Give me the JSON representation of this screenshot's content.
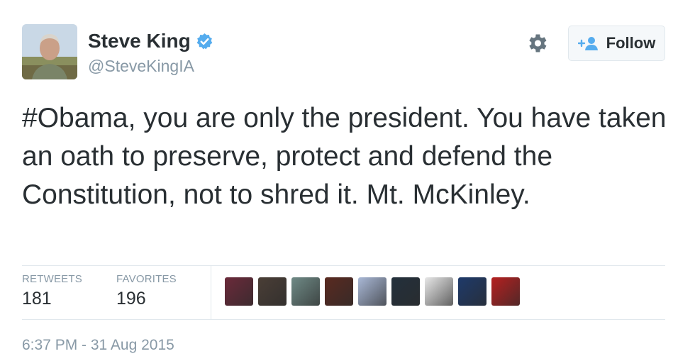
{
  "user": {
    "name": "Steve King",
    "handle": "@SteveKingIA",
    "verified": true
  },
  "actions": {
    "settings_icon": "gear-icon",
    "follow_label": "Follow",
    "follow_icon": "add-person-icon"
  },
  "tweet": {
    "text": "#Obama, you are only the president. You have taken an oath to preserve, protect and defend the Constitution, not to shred it. Mt. McKinley."
  },
  "stats": {
    "retweets_label": "RETWEETS",
    "retweets_value": "181",
    "favorites_label": "FAVORITES",
    "favorites_value": "196"
  },
  "favoriters": [
    {
      "name": "favoriter-avatar-1",
      "color": "#6b2a3a"
    },
    {
      "name": "favoriter-avatar-2",
      "color": "#4a3e36"
    },
    {
      "name": "favoriter-avatar-3",
      "color": "#6f8a86"
    },
    {
      "name": "favoriter-avatar-4",
      "color": "#5a2a20"
    },
    {
      "name": "favoriter-avatar-5",
      "color": "#a9b8d6"
    },
    {
      "name": "favoriter-avatar-6",
      "color": "#23303c"
    },
    {
      "name": "favoriter-avatar-7",
      "color": "#e8e8e8"
    },
    {
      "name": "favoriter-avatar-8",
      "color": "#1e3a6a"
    },
    {
      "name": "favoriter-avatar-9",
      "color": "#b52020"
    }
  ],
  "timestamp": "6:37 PM - 31 Aug 2015",
  "colors": {
    "accent": "#55acee",
    "text": "#292f33",
    "muted": "#8899a6",
    "border": "#e1e8ed"
  }
}
